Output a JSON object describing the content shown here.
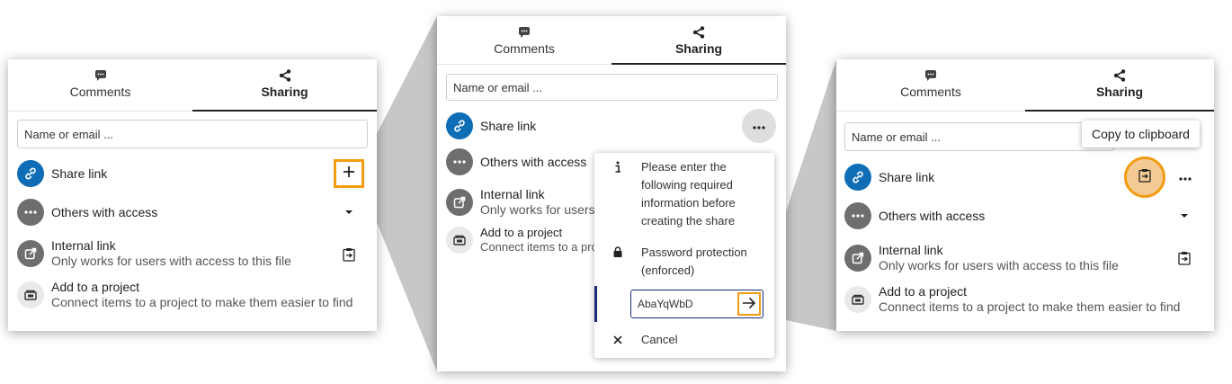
{
  "tabs": {
    "comments": "Comments",
    "sharing": "Sharing"
  },
  "search": {
    "placeholder": "Name or email ..."
  },
  "rows": {
    "share_link": "Share link",
    "others_access": "Others with access",
    "internal_link": "Internal link",
    "internal_link_sub": "Only works for users with access to this file",
    "internal_link_sub_short": "Only works for users w",
    "project": "Add to a project",
    "project_sub": "Connect items to a project to make them easier to find",
    "project_sub_short": "Connect items to a pro"
  },
  "menu": {
    "info": "Please enter the following required information before creating the share",
    "password_label": "Password protection (enforced)",
    "password_value": "AbaYqWbD",
    "cancel": "Cancel"
  },
  "tooltip": {
    "copy": "Copy to clipboard"
  },
  "colors": {
    "accent_orange": "#f39c12",
    "link_blue": "#0f6db6",
    "avatar_gray": "#6e6e6e",
    "focus_navy": "#1c2a78"
  },
  "icons": [
    "comment-icon",
    "share-icon",
    "link-icon",
    "dots-icon",
    "external-link-icon",
    "project-icon",
    "plus-icon",
    "chevron-down-icon",
    "clipboard-icon",
    "info-icon",
    "lock-icon",
    "arrow-right-icon",
    "close-icon"
  ]
}
